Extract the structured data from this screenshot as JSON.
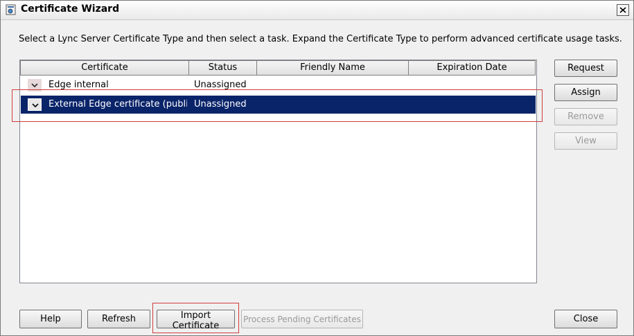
{
  "window": {
    "title": "Certificate Wizard"
  },
  "instruction": "Select a Lync Server Certificate Type and then select a task. Expand the Certificate Type to perform advanced certificate usage tasks.",
  "table": {
    "columns": [
      "Certificate",
      "Status",
      "Friendly Name",
      "Expiration Date"
    ],
    "rows": [
      {
        "certificate": "Edge internal",
        "status": "Unassigned",
        "friendly_name": "",
        "expiration_date": ""
      },
      {
        "certificate": "External Edge certificate (public i",
        "status": "Unassigned",
        "friendly_name": "",
        "expiration_date": ""
      }
    ],
    "selected_row": 1
  },
  "side_buttons": {
    "request": "Request",
    "assign": "Assign",
    "remove": "Remove",
    "view": "View"
  },
  "bottom_buttons": {
    "help": "Help",
    "refresh": "Refresh",
    "import": "Import Certificate",
    "process": "Process Pending Certificates",
    "close": "Close"
  },
  "icons": {
    "window": "certificate-wizard-icon",
    "close": "close-icon",
    "expand": "chevron-down-icon"
  },
  "colors": {
    "selection": "#0a246a",
    "highlight": "#d23c3c"
  }
}
